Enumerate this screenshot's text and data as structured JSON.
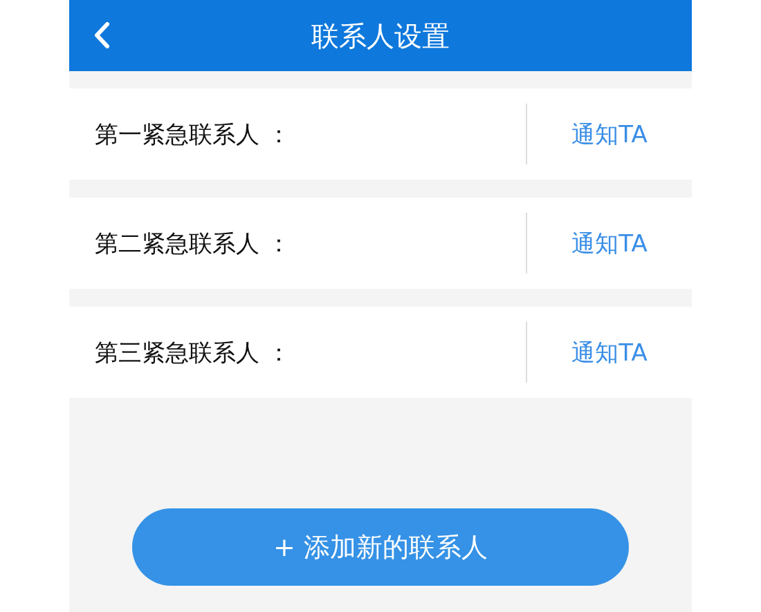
{
  "header": {
    "title": "联系人设置"
  },
  "contacts": [
    {
      "label": "第一紧急联系人 ：",
      "action": "通知TA"
    },
    {
      "label": "第二紧急联系人 ：",
      "action": "通知TA"
    },
    {
      "label": "第三紧急联系人 ：",
      "action": "通知TA"
    }
  ],
  "add_button": {
    "label": "+ 添加新的联系人"
  }
}
